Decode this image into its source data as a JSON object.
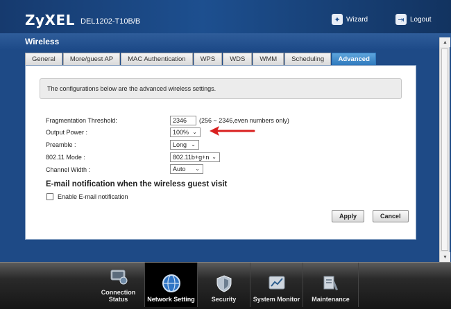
{
  "header": {
    "brand": "ZyXEL",
    "model": "DEL1202-T10B/B",
    "wizard_label": "Wizard",
    "logout_label": "Logout"
  },
  "page": {
    "title": "Wireless"
  },
  "tabs": [
    {
      "label": "General"
    },
    {
      "label": "More/guest AP"
    },
    {
      "label": "MAC Authentication"
    },
    {
      "label": "WPS"
    },
    {
      "label": "WDS"
    },
    {
      "label": "WMM"
    },
    {
      "label": "Scheduling"
    },
    {
      "label": "Advanced",
      "active": true
    }
  ],
  "content": {
    "info_text": "The configurations below are the advanced wireless settings.",
    "fragmentation": {
      "label": "Fragmentation Threshold:",
      "value": "2346",
      "hint": "(256 ~ 2346,even numbers only)"
    },
    "output_power": {
      "label": "Output Power :",
      "value": "100%"
    },
    "preamble": {
      "label": "Preamble :",
      "value": "Long"
    },
    "mode": {
      "label": "802.11 Mode :",
      "value": "802.11b+g+n"
    },
    "channel_width": {
      "label": "Channel Width :",
      "value": "Auto"
    },
    "email_section_title": "E-mail notification when the wireless guest visit",
    "email_checkbox_label": "Enable E-mail notification",
    "email_enabled": false,
    "apply_label": "Apply",
    "cancel_label": "Cancel"
  },
  "nav": [
    {
      "label": "Connection Status",
      "icon": "monitor-icon"
    },
    {
      "label": "Network Setting",
      "icon": "globe-icon",
      "active": true
    },
    {
      "label": "Security",
      "icon": "shield-icon"
    },
    {
      "label": "System Monitor",
      "icon": "chart-icon"
    },
    {
      "label": "Maintenance",
      "icon": "tools-icon"
    }
  ],
  "colors": {
    "header_blue": "#1d4f8f",
    "active_tab": "#2f79bd",
    "annotation_arrow": "#d9201f"
  }
}
